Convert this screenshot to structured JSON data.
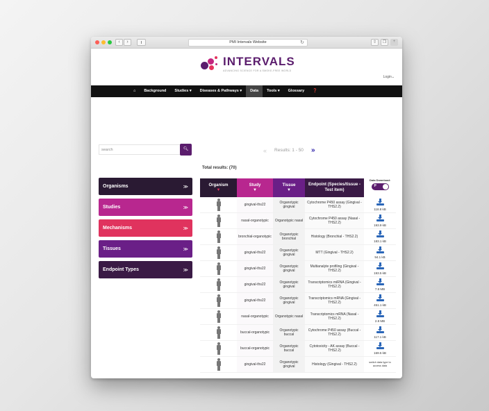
{
  "browser": {
    "url_title": "PMI Intervals Website",
    "nav_back": "‹",
    "nav_forward": "›"
  },
  "header": {
    "logo_title": "INTERVALS",
    "logo_tagline": "ADVANCING SCIENCE FOR A SMOKE-FREE WORLD",
    "login": "Login"
  },
  "nav": {
    "items": [
      "Background",
      "Studies",
      "Diseases & Pathways",
      "Data",
      "Tools",
      "Glossary"
    ],
    "active": "Data"
  },
  "search": {
    "placeholder": "search"
  },
  "pager": {
    "results_text": "Results: 1 - 50"
  },
  "total_results": "Total results: (70)",
  "facets": [
    {
      "label": "Organisms",
      "color": "#2a1a33"
    },
    {
      "label": "Studies",
      "color": "#b8278f"
    },
    {
      "label": "Mechanisms",
      "color": "#e0335e"
    },
    {
      "label": "Tissues",
      "color": "#6a1f87"
    },
    {
      "label": "Endpoint Types",
      "color": "#3a1a45"
    }
  ],
  "table": {
    "columns": [
      "Organism",
      "Study",
      "Tissue",
      "Endpoint (Species/tissue - Test item)"
    ],
    "header_colors": [
      "#2a1a33",
      "#b8278f",
      "#6a1f87",
      "#3a1a45"
    ],
    "download_label": "Data Download:",
    "toggle_label": "P",
    "switch_note": "switch data type to access data",
    "rows": [
      {
        "study": "gingival-ths22",
        "tissue": "Organotypic gingival",
        "endpoint": "Cytochrome P450 assay (Gingival - THS2.2)",
        "size": "118.8 kB"
      },
      {
        "study": "nasal-organotypic",
        "tissue": "Organotypic nasal",
        "endpoint": "Cytochrome P450 assay (Nasal - THS2.2)",
        "size": "193.9 kB"
      },
      {
        "study": "bronchial-organotypic",
        "tissue": "Organotypic bronchial",
        "endpoint": "Histology (Bronchial - THS2.2)",
        "size": "183.1 kB"
      },
      {
        "study": "gingival-ths22",
        "tissue": "Organotypic gingival",
        "endpoint": "MTT (Gingival - THS2.2)",
        "size": "94.1 kB"
      },
      {
        "study": "gingival-ths22",
        "tissue": "Organotypic gingival",
        "endpoint": "Multianalyte profiling (Gingival - THS2.2)",
        "size": "193.5 kB"
      },
      {
        "study": "gingival-ths22",
        "tissue": "Organotypic gingival",
        "endpoint": "Transcriptomics miRNA (Gingival - THS2.2)",
        "size": "7.8 MB"
      },
      {
        "study": "gingival-ths22",
        "tissue": "Organotypic gingival",
        "endpoint": "Transcriptomics mRNA (Gingival - THS2.2)",
        "size": "451.1 kB"
      },
      {
        "study": "nasal-organotypic",
        "tissue": "Organotypic nasal",
        "endpoint": "Transcriptomics mRNA (Nasal - THS2.2)",
        "size": "2.8 MB"
      },
      {
        "study": "buccal-organotypic",
        "tissue": "Organotypic buccal",
        "endpoint": "Cytochrome P450 assay (Buccal - THS2.2)",
        "size": "117.1 kB"
      },
      {
        "study": "buccal-organotypic",
        "tissue": "Organotypic buccal",
        "endpoint": "Cytotoxicity - AK assay (Buccal - THS2.2)",
        "size": "169.5 kB"
      },
      {
        "study": "gingival-ths22",
        "tissue": "Organotypic gingival",
        "endpoint": "Histology (Gingival - THS2.2)",
        "size": ""
      }
    ]
  }
}
